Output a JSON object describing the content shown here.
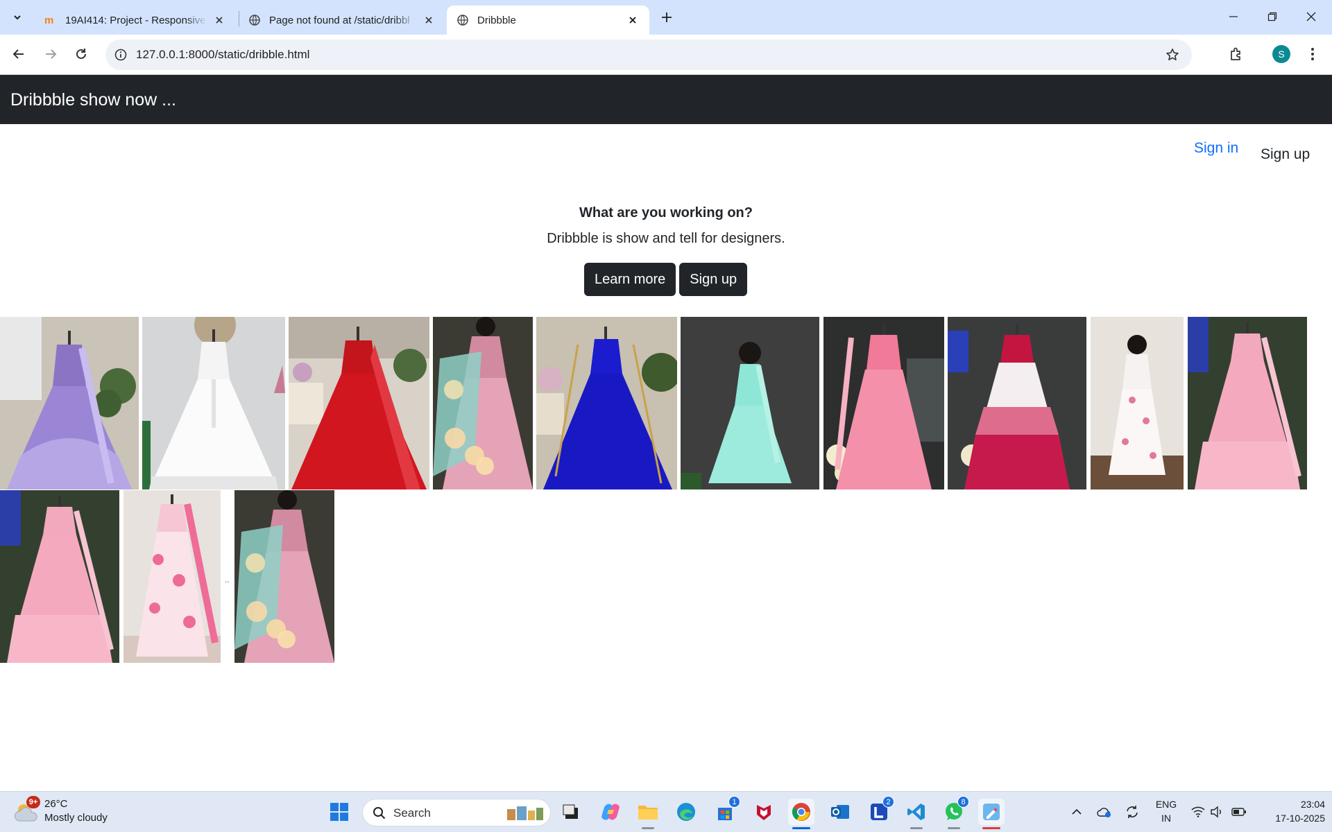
{
  "browser": {
    "tabs": [
      {
        "title": "19AI414: Project - Responsive W",
        "favicon": "moodle-icon",
        "active": false
      },
      {
        "title": "Page not found at /static/dribbl",
        "favicon": "globe-icon",
        "active": false
      },
      {
        "title": "Dribbble",
        "favicon": "globe-icon",
        "active": true
      }
    ],
    "url": "127.0.0.1:8000/static/dribble.html",
    "profile_initial": "S",
    "profile_color": "#0b8a93"
  },
  "site": {
    "brand": "Dribbble show now ...",
    "sign_in": "Sign in",
    "sign_up_link": "Sign up",
    "hero_title": "What are you working on?",
    "hero_subtitle": "Dribbble is show and tell for designers.",
    "learn_more": "Learn more",
    "sign_up_button": "Sign up",
    "separator_text": "..",
    "gallery": [
      {
        "desc": "lavender lehenga"
      },
      {
        "desc": "white gown"
      },
      {
        "desc": "red gown"
      },
      {
        "desc": "pink floral lehenga"
      },
      {
        "desc": "royal blue gown"
      },
      {
        "desc": "mint saree gown"
      },
      {
        "desc": "pink lehenga"
      },
      {
        "desc": "red white ombre lehenga"
      },
      {
        "desc": "white floral dress"
      },
      {
        "desc": "pink ruffle gown"
      },
      {
        "desc": "pink ruffle gown"
      },
      {
        "desc": "pink floral gown"
      },
      {
        "desc": "pink floral lehenga"
      }
    ]
  },
  "taskbar": {
    "weather_badge": "9+",
    "temperature": "26°C",
    "condition": "Mostly cloudy",
    "search_label": "Search",
    "store_badge": "1",
    "l_badge": "2",
    "whatsapp_badge": "8",
    "lang_top": "ENG",
    "lang_bottom": "IN",
    "time": "23:04",
    "date": "17-10-2025"
  }
}
